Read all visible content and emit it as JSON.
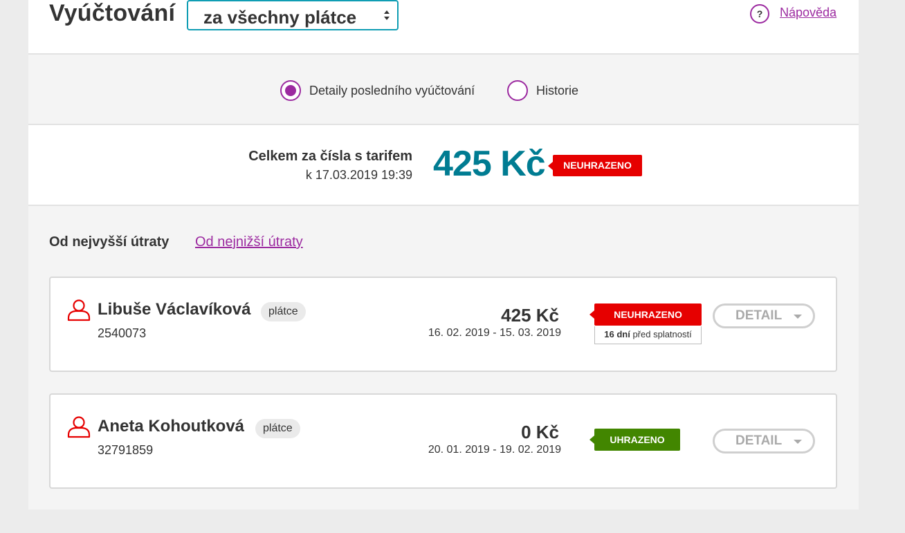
{
  "header": {
    "title": "Vyúčtování",
    "select_value": "za všechny plátce",
    "help_icon": "?",
    "help_label": "Nápověda"
  },
  "view_toggle": {
    "options": [
      {
        "label": "Detaily posledního vyúčtování",
        "selected": true
      },
      {
        "label": "Historie",
        "selected": false
      }
    ]
  },
  "total": {
    "label": "Celkem za čísla s tarifem",
    "date": "k 17.03.2019 19:39",
    "amount": "425 Kč",
    "status": "NEUHRAZENO"
  },
  "sort": {
    "active": "Od nejvyšší útraty",
    "link": "Od nejnižší útraty"
  },
  "payers": [
    {
      "name": "Libuše Václavíková",
      "role": "plátce",
      "number": "2540073",
      "amount": "425 Kč",
      "period": "16. 02. 2019 - 15. 03. 2019",
      "status": "NEUHRAZENO",
      "status_color": "#e60000",
      "due_days": "16 dní",
      "due_text": " před splatností",
      "detail_label": "DETAIL"
    },
    {
      "name": "Aneta Kohoutková",
      "role": "plátce",
      "number": "32791859",
      "amount": "0 Kč",
      "period": "20. 01. 2019 - 19. 02. 2019",
      "status": "UHRAZENO",
      "status_color": "#428600",
      "detail_label": "DETAIL"
    }
  ],
  "colors": {
    "accent_purple": "#9c2aa0",
    "teal": "#007c92",
    "select_border": "#0f9db3",
    "unpaid_red": "#e60000",
    "paid_green": "#428600"
  },
  "icons": {
    "select": "select-arrows-icon",
    "help": "question-circle-icon",
    "user": "user-icon",
    "detail": "caret-down-icon"
  }
}
